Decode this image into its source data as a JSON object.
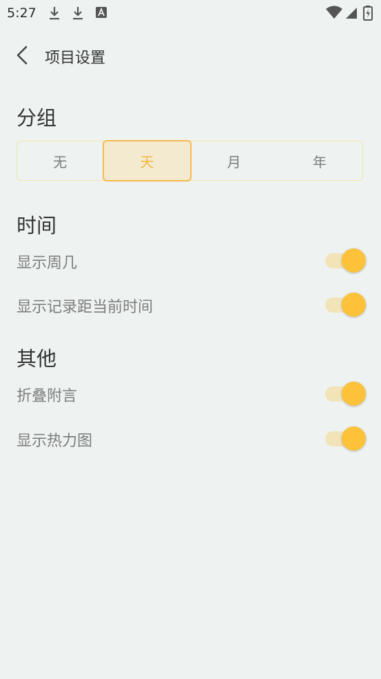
{
  "status_bar": {
    "time": "5:27",
    "icons": [
      "download-icon",
      "download-icon",
      "app-a-icon",
      "wifi-icon",
      "signal-icon",
      "battery-icon"
    ]
  },
  "header": {
    "title": "项目设置",
    "back_icon": "chevron-left-icon"
  },
  "group": {
    "title": "分组",
    "options": [
      "无",
      "天",
      "月",
      "年"
    ],
    "selected": "天"
  },
  "time_section": {
    "title": "时间",
    "items": [
      {
        "label": "显示周几",
        "on": true
      },
      {
        "label": "显示记录距当前时间",
        "on": true
      }
    ]
  },
  "other_section": {
    "title": "其他",
    "items": [
      {
        "label": "折叠附言",
        "on": true
      },
      {
        "label": "显示热力图",
        "on": true
      }
    ]
  },
  "colors": {
    "background": "#eef3f2",
    "accent": "#fbc23a",
    "accent_track": "#f3e3b8",
    "selected_border": "#f7b84a",
    "selected_text": "#f5b63a"
  }
}
